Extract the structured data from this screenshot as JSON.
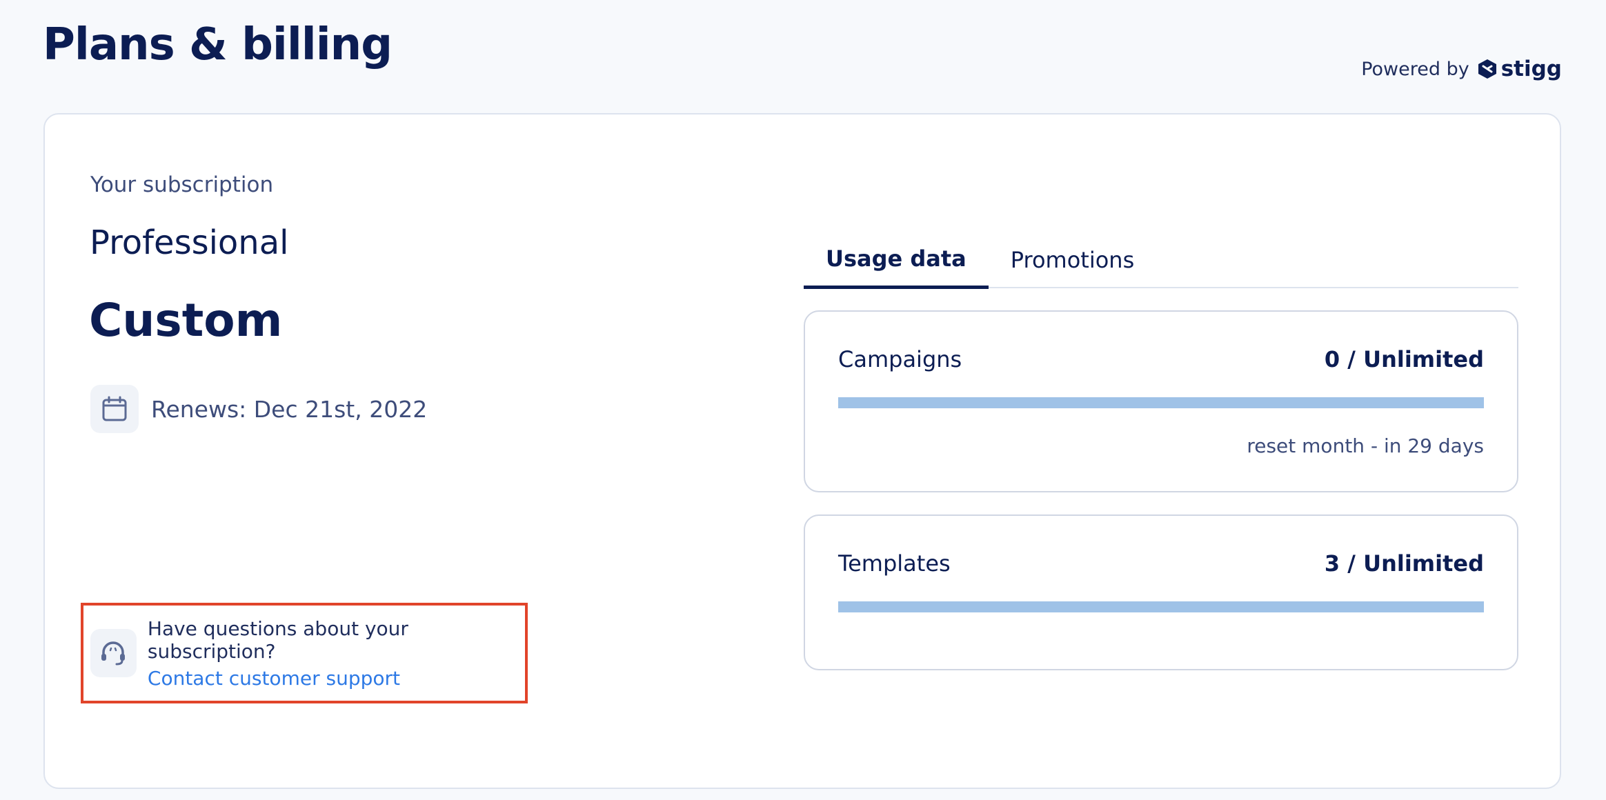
{
  "header": {
    "title": "Plans & billing",
    "powered_by": "Powered by",
    "brand": "stigg"
  },
  "subscription": {
    "label": "Your subscription",
    "plan": "Professional",
    "price": "Custom",
    "renews": "Renews: Dec 21st, 2022",
    "renew_icon": "calendar-icon"
  },
  "support": {
    "question": "Have questions about your subscription?",
    "link": "Contact customer support",
    "icon": "headset-icon",
    "highlight_color": "#e1442a"
  },
  "tabs": [
    {
      "label": "Usage data",
      "active": true
    },
    {
      "label": "Promotions",
      "active": false
    }
  ],
  "usage": [
    {
      "name": "Campaigns",
      "value": "0 / Unlimited",
      "reset": "reset month - in 29 days",
      "fill_fraction": 0
    },
    {
      "name": "Templates",
      "value": "3 / Unlimited",
      "fill_fraction": 0
    }
  ],
  "colors": {
    "primary": "#0c1d53",
    "link": "#2d79e5",
    "bar": "#9fc2e7"
  }
}
